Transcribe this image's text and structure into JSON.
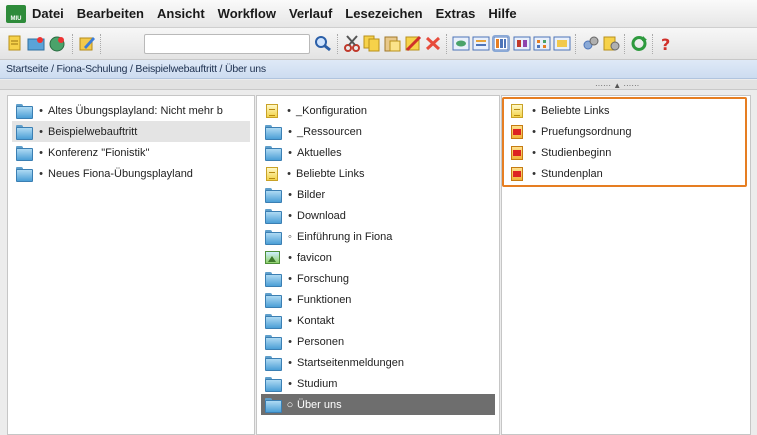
{
  "menubar": {
    "logo_text": "MIU",
    "items": [
      "Datei",
      "Bearbeiten",
      "Ansicht",
      "Workflow",
      "Verlauf",
      "Lesezeichen",
      "Extras",
      "Hilfe"
    ]
  },
  "toolbar": {
    "search_value": ""
  },
  "breadcrumb": "Startseite / Fiona-Schulung / Beispielwebauftritt / Über uns",
  "columns": {
    "col1": [
      {
        "label": "Altes Übungsplayland: Nicht mehr b",
        "icon": "folder",
        "marker": "•",
        "state": "normal"
      },
      {
        "label": "Beispielwebauftritt",
        "icon": "folder",
        "marker": "•",
        "state": "selected"
      },
      {
        "label": "Konferenz \"Fionistik\"",
        "icon": "folder",
        "marker": "•",
        "state": "normal"
      },
      {
        "label": "Neues Fiona-Übungsplayland",
        "icon": "folder",
        "marker": "•",
        "state": "normal"
      }
    ],
    "col2": [
      {
        "label": "_Konfiguration",
        "icon": "document",
        "marker": "•",
        "state": "normal"
      },
      {
        "label": "_Ressourcen",
        "icon": "folder",
        "marker": "•",
        "state": "normal"
      },
      {
        "label": "Aktuelles",
        "icon": "folder",
        "marker": "•",
        "state": "normal"
      },
      {
        "label": "Beliebte Links",
        "icon": "document",
        "marker": "•",
        "state": "normal"
      },
      {
        "label": "Bilder",
        "icon": "folder",
        "marker": "•",
        "state": "normal"
      },
      {
        "label": "Download",
        "icon": "folder",
        "marker": "•",
        "state": "normal"
      },
      {
        "label": "Einführung in Fiona",
        "icon": "folder",
        "marker": "◦",
        "state": "normal"
      },
      {
        "label": "favicon",
        "icon": "image",
        "marker": "•",
        "state": "normal"
      },
      {
        "label": "Forschung",
        "icon": "folder",
        "marker": "•",
        "state": "normal"
      },
      {
        "label": "Funktionen",
        "icon": "folder",
        "marker": "•",
        "state": "normal"
      },
      {
        "label": "Kontakt",
        "icon": "folder",
        "marker": "•",
        "state": "normal"
      },
      {
        "label": "Personen",
        "icon": "folder",
        "marker": "•",
        "state": "normal"
      },
      {
        "label": "Startseitenmeldungen",
        "icon": "folder",
        "marker": "•",
        "state": "normal"
      },
      {
        "label": "Studium",
        "icon": "folder",
        "marker": "•",
        "state": "normal"
      },
      {
        "label": "Über uns",
        "icon": "folder",
        "marker": "○",
        "state": "active"
      }
    ],
    "col3": [
      {
        "label": "Beliebte Links",
        "icon": "document",
        "marker": "•",
        "state": "normal"
      },
      {
        "label": "Pruefungsordnung",
        "icon": "pdf-document",
        "marker": "•",
        "state": "normal"
      },
      {
        "label": "Studienbeginn",
        "icon": "pdf-document",
        "marker": "•",
        "state": "normal"
      },
      {
        "label": "Stundenplan",
        "icon": "pdf-document",
        "marker": "•",
        "state": "normal"
      }
    ]
  },
  "colors": {
    "highlight_border": "#e67e22",
    "active_row": "#6e6e6e",
    "selected_row": "#e4e4e4",
    "breadcrumb_bg": "#d6e3f5"
  }
}
